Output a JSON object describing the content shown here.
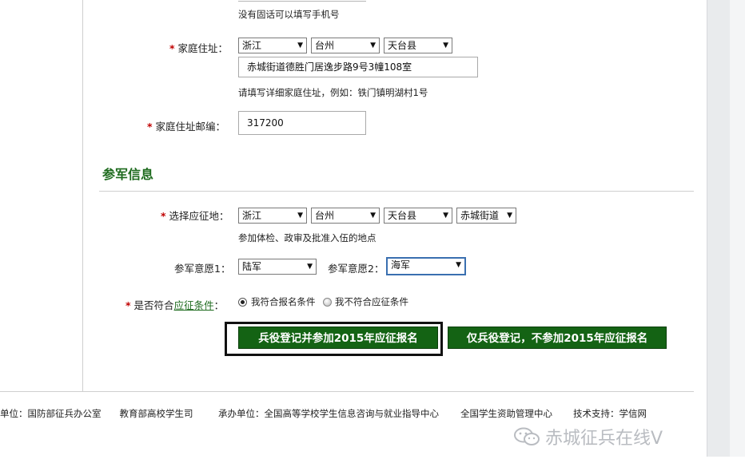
{
  "top": {
    "phone_hint": "没有固话可以填写手机号"
  },
  "home_address": {
    "label": "家庭住址：",
    "province": "浙江",
    "city": "台州",
    "county": "天台县",
    "detail_value": "赤城街道德胜门居逸步路9号3幢108室",
    "hint": "请填写详细家庭住址，例如：铁门镇明湖村1号"
  },
  "postcode": {
    "label": "家庭住址邮编：",
    "value": "317200"
  },
  "military": {
    "title": "参军信息",
    "location_label": "选择应征地：",
    "location": {
      "province": "浙江",
      "city": "台州",
      "county": "天台县",
      "street": "赤城街道"
    },
    "location_hint": "参加体检、政审及批准入伍的地点",
    "wish1_label": "参军意愿1：",
    "wish1_value": "陆军",
    "wish2_label": "参军意愿2：",
    "wish2_value": "海军",
    "eligible_label_prefix": "是否符合",
    "eligible_link": "应征条件",
    "eligible_label_suffix": "：",
    "option_yes": "我符合报名条件",
    "option_no": "我不符合应征条件",
    "selected": "yes"
  },
  "buttons": {
    "register_and_apply": "兵役登记并参加2015年应征报名",
    "register_only": "仅兵役登记，不参加2015年应征报名"
  },
  "footer": {
    "host_units": "单位：国防部征兵办公室　　教育部高校学生司",
    "organizer": "承办单位：全国高等学校学生信息咨询与就业指导中心",
    "aid_center": "全国学生资助管理中心",
    "tech_support": "技术支持：学信网"
  },
  "watermark": {
    "text": "赤城征兵在线V"
  },
  "colors": {
    "accent_green": "#146314",
    "title_green": "#1d6a1d",
    "required_star": "#c00000"
  }
}
